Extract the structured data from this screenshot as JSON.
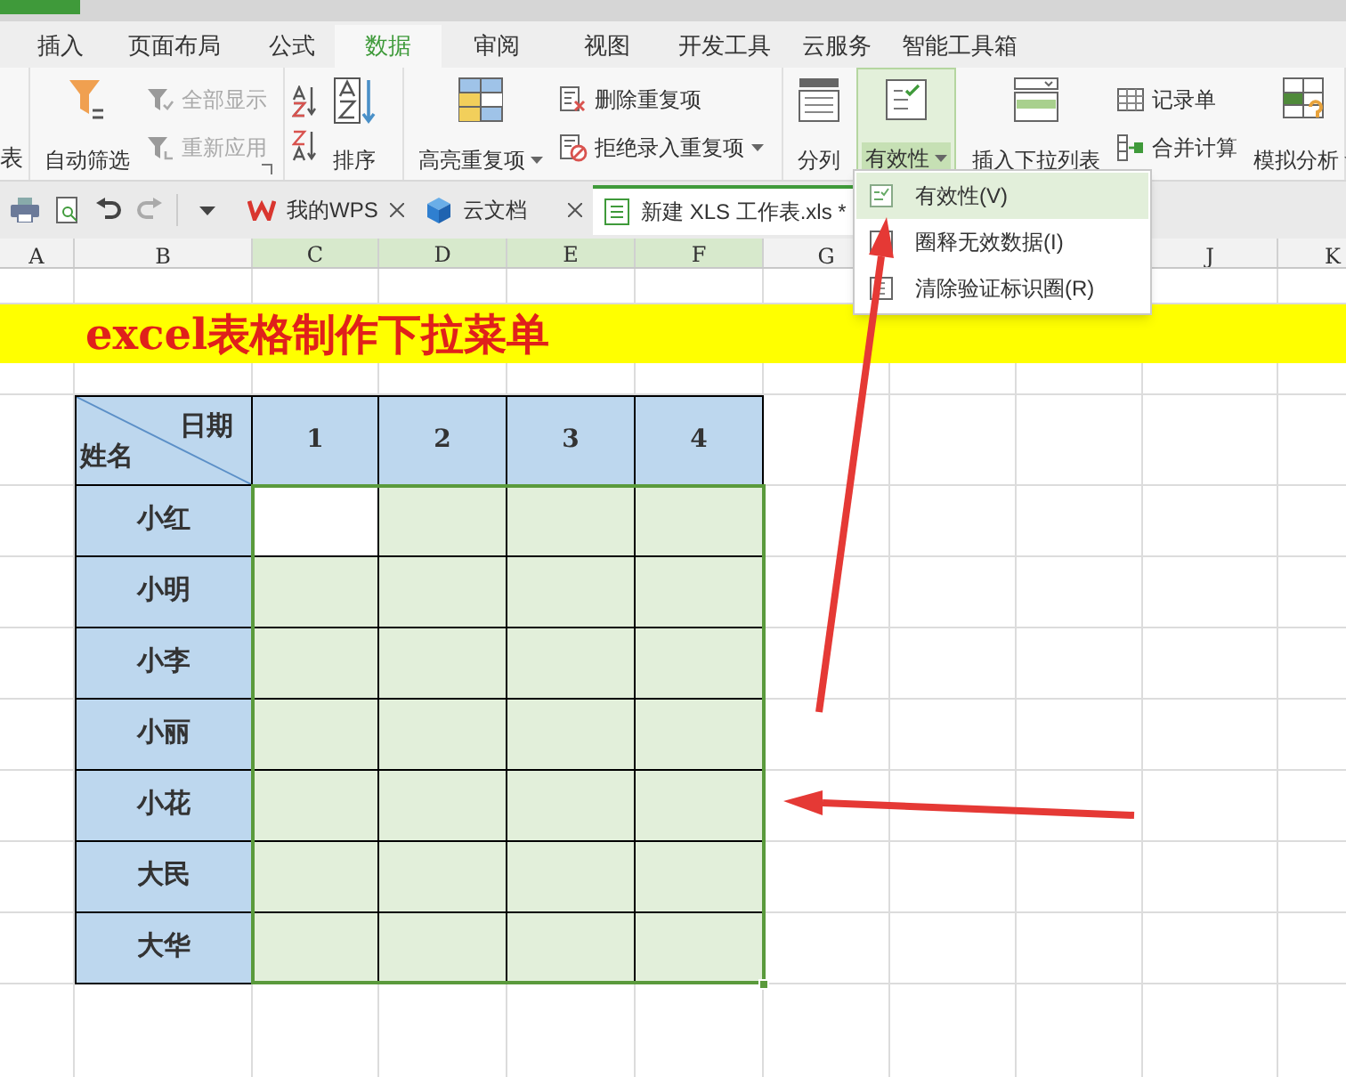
{
  "tabs": [
    {
      "label": "插入",
      "selected": false
    },
    {
      "label": "页面布局",
      "selected": false
    },
    {
      "label": "公式",
      "selected": false
    },
    {
      "label": "数据",
      "selected": true
    },
    {
      "label": "审阅",
      "selected": false
    },
    {
      "label": "视图",
      "selected": false
    },
    {
      "label": "开发工具",
      "selected": false
    },
    {
      "label": "云服务",
      "selected": false
    },
    {
      "label": "智能工具箱",
      "selected": false
    }
  ],
  "ribbon": {
    "groups": [
      {
        "items": [
          {
            "kind": "cut",
            "label": "表"
          }
        ]
      },
      {
        "items": [
          {
            "kind": "large",
            "label": "自动筛选",
            "dropdown": false,
            "pressed": false
          },
          {
            "kind": "small",
            "label": "全部显示",
            "disabled": true,
            "dropdown": false
          },
          {
            "kind": "small",
            "label": "重新应用",
            "disabled": true,
            "dropdown": false
          }
        ]
      },
      {
        "items": [
          {
            "kind": "iconpair"
          },
          {
            "kind": "large",
            "label": "排序",
            "dropdown": false,
            "pressed": false
          }
        ]
      },
      {
        "items": [
          {
            "kind": "large",
            "label": "高亮重复项",
            "dropdown": true,
            "pressed": false
          },
          {
            "kind": "small",
            "label": "删除重复项",
            "disabled": false,
            "dropdown": false
          },
          {
            "kind": "small",
            "label": "拒绝录入重复项",
            "disabled": false,
            "dropdown": true
          }
        ]
      },
      {
        "items": [
          {
            "kind": "large",
            "label": "分列",
            "dropdown": false,
            "pressed": false
          },
          {
            "kind": "large",
            "label": "有效性",
            "dropdown": true,
            "pressed": true
          },
          {
            "kind": "large",
            "label": "插入下拉列表",
            "dropdown": false,
            "pressed": false
          },
          {
            "kind": "small",
            "label": "记录单",
            "disabled": false,
            "dropdown": false
          },
          {
            "kind": "small",
            "label": "合并计算",
            "disabled": false,
            "dropdown": false
          },
          {
            "kind": "large",
            "label": "模拟分析",
            "dropdown": true,
            "pressed": false
          }
        ]
      }
    ]
  },
  "doc_tabs": [
    {
      "label": "我的WPS",
      "closable": true,
      "selected": false
    },
    {
      "label": "云文档",
      "closable": true,
      "selected": false
    },
    {
      "label": "新建 XLS 工作表.xls *",
      "closable": false,
      "selected": true
    }
  ],
  "validity_menu": [
    {
      "label": "有效性(V)",
      "selected": true
    },
    {
      "label": "圈释无效数据(I)",
      "selected": false
    },
    {
      "label": "清除验证标识圈(R)",
      "selected": false
    }
  ],
  "columns": [
    {
      "letter": "A",
      "selected": false
    },
    {
      "letter": "B",
      "selected": false
    },
    {
      "letter": "C",
      "selected": true
    },
    {
      "letter": "D",
      "selected": true
    },
    {
      "letter": "E",
      "selected": true
    },
    {
      "letter": "F",
      "selected": true
    },
    {
      "letter": "G",
      "selected": false
    },
    {
      "letter": "J",
      "selected": false
    },
    {
      "letter": "K",
      "selected": false
    }
  ],
  "banner": "excel表格制作下拉菜单",
  "table": {
    "corner_top": "日期",
    "corner_bottom": "姓名",
    "headers": [
      "1",
      "2",
      "3",
      "4"
    ],
    "rows": [
      {
        "name": "小红",
        "cells": [
          {
            "active": true
          },
          {
            "active": false
          },
          {
            "active": false
          },
          {
            "active": false
          }
        ]
      },
      {
        "name": "小明",
        "cells": [
          {
            "active": false
          },
          {
            "active": false
          },
          {
            "active": false
          },
          {
            "active": false
          }
        ]
      },
      {
        "name": "小李",
        "cells": [
          {
            "active": false
          },
          {
            "active": false
          },
          {
            "active": false
          },
          {
            "active": false
          }
        ]
      },
      {
        "name": "小丽",
        "cells": [
          {
            "active": false
          },
          {
            "active": false
          },
          {
            "active": false
          },
          {
            "active": false
          }
        ]
      },
      {
        "name": "小花",
        "cells": [
          {
            "active": false
          },
          {
            "active": false
          },
          {
            "active": false
          },
          {
            "active": false
          }
        ]
      },
      {
        "name": "大民",
        "cells": [
          {
            "active": false
          },
          {
            "active": false
          },
          {
            "active": false
          },
          {
            "active": false
          }
        ]
      },
      {
        "name": "大华",
        "cells": [
          {
            "active": false
          },
          {
            "active": false
          },
          {
            "active": false
          },
          {
            "active": false
          }
        ]
      }
    ]
  }
}
